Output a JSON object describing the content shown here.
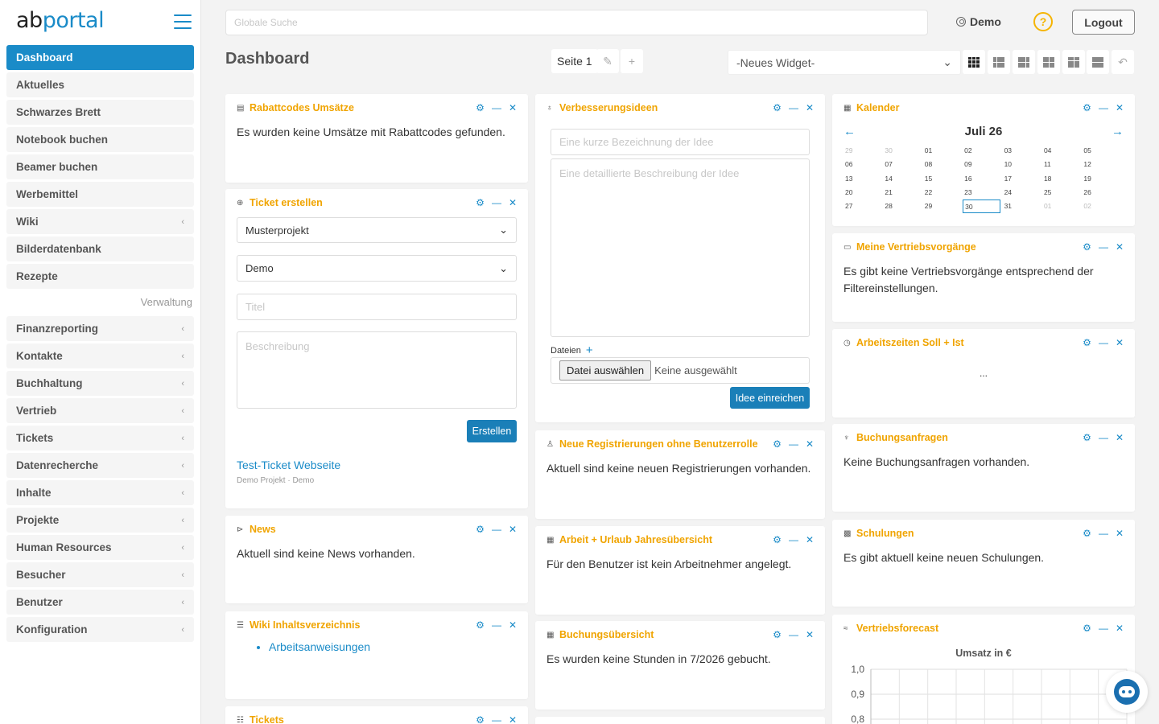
{
  "logo": {
    "ab": "ab",
    "portal": "portal"
  },
  "sidebar": {
    "items": [
      {
        "label": "Dashboard",
        "active": true,
        "chevron": ""
      },
      {
        "label": "Aktuelles",
        "chevron": ""
      },
      {
        "label": "Schwarzes Brett",
        "chevron": ""
      },
      {
        "label": "Notebook buchen",
        "chevron": ""
      },
      {
        "label": "Beamer buchen",
        "chevron": ""
      },
      {
        "label": "Werbemittel",
        "chevron": ""
      },
      {
        "label": "Wiki",
        "chevron": "‹"
      },
      {
        "label": "Bilderdatenbank",
        "chevron": ""
      },
      {
        "label": "Rezepte",
        "chevron": ""
      }
    ],
    "section": "Verwaltung",
    "admin_items": [
      {
        "label": "Finanzreporting",
        "chevron": "‹"
      },
      {
        "label": "Kontakte",
        "chevron": "‹"
      },
      {
        "label": "Buchhaltung",
        "chevron": "‹"
      },
      {
        "label": "Vertrieb",
        "chevron": "‹"
      },
      {
        "label": "Tickets",
        "chevron": "‹"
      },
      {
        "label": "Datenrecherche",
        "chevron": "‹"
      },
      {
        "label": "Inhalte",
        "chevron": "‹"
      },
      {
        "label": "Projekte",
        "chevron": "‹"
      },
      {
        "label": "Human Resources",
        "chevron": "‹"
      },
      {
        "label": "Besucher",
        "chevron": "‹"
      },
      {
        "label": "Benutzer",
        "chevron": "‹"
      },
      {
        "label": "Konfiguration",
        "chevron": "‹"
      }
    ]
  },
  "header": {
    "search_placeholder": "Globale Suche",
    "user": "Demo",
    "help": "?",
    "logout": "Logout"
  },
  "page": {
    "title": "Dashboard",
    "tab": "Seite 1",
    "edit_icon": "✎",
    "add_icon": "+",
    "widget_select": "-Neues Widget-",
    "widget_select_chevron": "⌄",
    "undo_icon": "↶"
  },
  "widgets": {
    "rabattcodes": {
      "title": "Rabattcodes Umsätze",
      "text": "Es wurden keine Umsätze mit Rabattcodes gefunden."
    },
    "ticket": {
      "title": "Ticket erstellen",
      "project": "Musterprojekt",
      "user": "Demo",
      "title_placeholder": "Titel",
      "desc_placeholder": "Beschreibung",
      "submit": "Erstellen",
      "link": "Test-Ticket Webseite",
      "meta": "Demo Projekt · Demo"
    },
    "news": {
      "title": "News",
      "text": "Aktuell sind keine News vorhanden."
    },
    "wiki": {
      "title": "Wiki Inhaltsverzeichnis",
      "item": "Arbeitsanweisungen"
    },
    "tickets": {
      "title": "Tickets"
    },
    "ideen": {
      "title": "Verbesserungsideen",
      "name_placeholder": "Eine kurze Bezeichnung der Idee",
      "desc_placeholder": "Eine detaillierte Beschreibung der Idee",
      "files_label": "Dateien",
      "file_button": "Datei auswählen",
      "file_status": "Keine ausgewählt",
      "submit": "Idee einreichen"
    },
    "registrierungen": {
      "title": "Neue Registrierungen ohne Benutzerrolle",
      "text": "Aktuell sind keine neuen Registrierungen vorhanden."
    },
    "arbeit": {
      "title": "Arbeit + Urlaub Jahresübersicht",
      "text": "Für den Benutzer ist kein Arbeitnehmer angelegt."
    },
    "buchung": {
      "title": "Buchungsübersicht",
      "text": "Es wurden keine Stunden in 7/2026 gebucht."
    },
    "kalender": {
      "title": "Kalender",
      "month": "Juli 26",
      "prev": "←",
      "next": "→",
      "days": [
        {
          "d": "29",
          "muted": true
        },
        {
          "d": "30",
          "muted": true
        },
        {
          "d": "01"
        },
        {
          "d": "02"
        },
        {
          "d": "03"
        },
        {
          "d": "04"
        },
        {
          "d": "05"
        },
        {
          "d": "06"
        },
        {
          "d": "07"
        },
        {
          "d": "08"
        },
        {
          "d": "09"
        },
        {
          "d": "10"
        },
        {
          "d": "11"
        },
        {
          "d": "12"
        },
        {
          "d": "13"
        },
        {
          "d": "14"
        },
        {
          "d": "15"
        },
        {
          "d": "16"
        },
        {
          "d": "17"
        },
        {
          "d": "18"
        },
        {
          "d": "19"
        },
        {
          "d": "20"
        },
        {
          "d": "21"
        },
        {
          "d": "22"
        },
        {
          "d": "23"
        },
        {
          "d": "24"
        },
        {
          "d": "25"
        },
        {
          "d": "26"
        },
        {
          "d": "27"
        },
        {
          "d": "28"
        },
        {
          "d": "29"
        },
        {
          "d": "30",
          "today": true
        },
        {
          "d": "31"
        },
        {
          "d": "01",
          "muted": true
        },
        {
          "d": "02",
          "muted": true
        }
      ]
    },
    "vertriebsvorgaenge": {
      "title": "Meine Vertriebsvorgänge",
      "text": "Es gibt keine Vertriebsvorgänge entsprechend der Filtereinstellungen."
    },
    "arbeitszeiten": {
      "title": "Arbeitszeiten Soll + Ist",
      "text": "..."
    },
    "buchungsanfragen": {
      "title": "Buchungsanfragen",
      "text": "Keine Buchungsanfragen vorhanden."
    },
    "schulungen": {
      "title": "Schulungen",
      "text": "Es gibt aktuell keine neuen Schulungen."
    },
    "forecast": {
      "title": "Vertriebsforecast"
    }
  },
  "chart_data": {
    "type": "line",
    "title": "Umsatz in €",
    "series": [],
    "ylim": [
      0.8,
      1.0
    ],
    "yticks": [
      "1,0",
      "0,9",
      "0,8"
    ],
    "grid": true
  },
  "colors": {
    "accent": "#1a8bc8",
    "widget_title": "#f0a400",
    "help": "#f5b400"
  }
}
